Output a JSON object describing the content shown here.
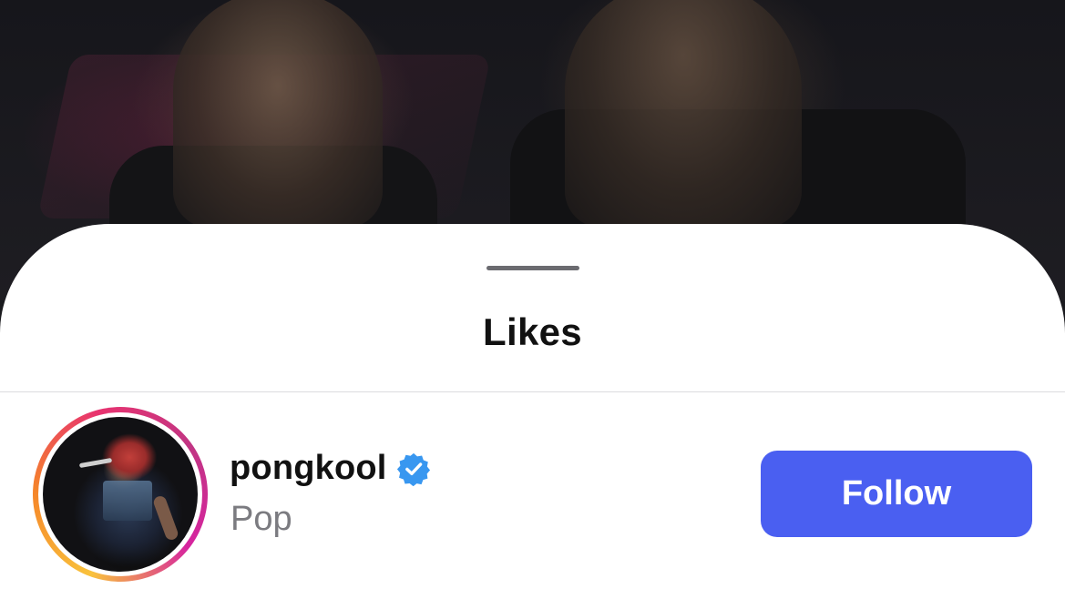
{
  "sheet": {
    "title": "Likes"
  },
  "likes": [
    {
      "username": "pongkool",
      "verified": true,
      "subtitle": "Pop",
      "button_label": "Follow",
      "avatar_icon": "profile-photo-with-story-ring"
    }
  ],
  "colors": {
    "follow_button": "#4a5ff1",
    "verified_badge": "#3897f0",
    "story_ring": [
      "#f9c23c",
      "#f58529",
      "#e8336f",
      "#c13584"
    ]
  }
}
